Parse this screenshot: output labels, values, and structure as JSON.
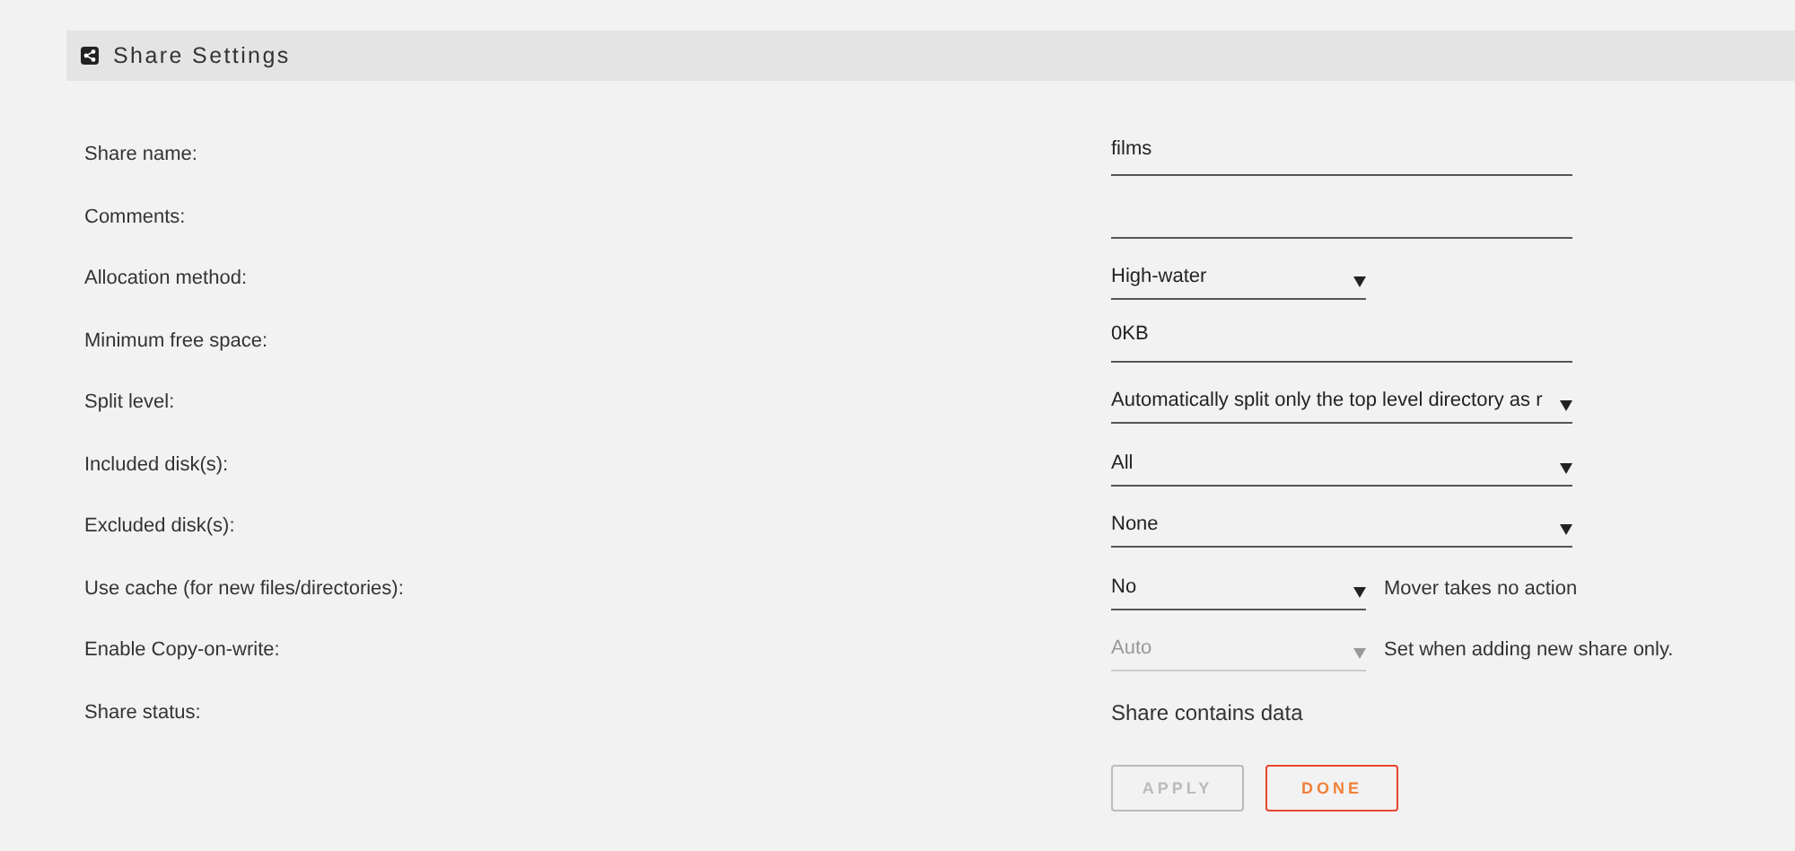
{
  "panel": {
    "title": "Share Settings"
  },
  "rows": [
    {
      "label": "Share name:",
      "kind": "input",
      "value": "films"
    },
    {
      "label": "Comments:",
      "kind": "input"
    },
    {
      "label": "Allocation method:",
      "kind": "narrowselect",
      "value": "High-water",
      "disabled": false
    },
    {
      "label": "Minimum free space:",
      "kind": "input",
      "value": "0KB"
    },
    {
      "label": "Split level:",
      "kind": "select",
      "value": "Automatically split only the top level directory as r",
      "disabled": false
    },
    {
      "label": "Included disk(s):",
      "kind": "select",
      "value": "All",
      "disabled": false
    },
    {
      "label": "Excluded disk(s):",
      "kind": "select",
      "value": "None",
      "disabled": false
    },
    {
      "label": "Use cache (for new files/directories):",
      "kind": "narrowselect",
      "value": "No",
      "disabled": false,
      "note": "Mover takes no action"
    },
    {
      "label": "Enable Copy-on-write:",
      "kind": "narrowselect",
      "value": "Auto",
      "disabled": true,
      "note": "Set when adding new share only."
    },
    {
      "label": "Share status:",
      "kind": "text",
      "value": "Share contains data"
    }
  ],
  "buttons": [
    {
      "label": "APPLY",
      "kind": "apply",
      "disabled": true
    },
    {
      "label": "DONE",
      "kind": "done",
      "disabled": false
    }
  ]
}
